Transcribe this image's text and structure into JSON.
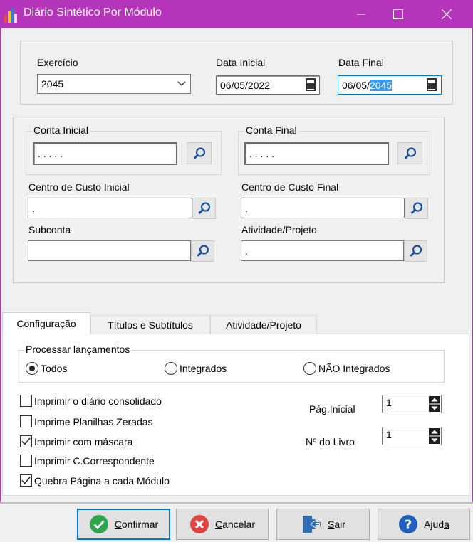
{
  "window": {
    "title": "Diário Sintético Por Módulo",
    "accent_color": "#b535ba",
    "controls": [
      "minimize-icon",
      "maximize-icon",
      "close-icon"
    ]
  },
  "period": {
    "exercicio_label": "Exercício",
    "exercicio_value": "2045",
    "data_inicial_label": "Data Inicial",
    "data_inicial_value": "06/05/2022",
    "data_final_label": "Data Final",
    "data_final_prefix": "06/05/",
    "data_final_selected": "2045"
  },
  "accounts": {
    "conta_inicial_label": "Conta Inicial",
    "conta_inicial_value": ". . . . .",
    "conta_final_label": "Conta Final",
    "conta_final_value": ". . . . .",
    "cc_inicial_label": "Centro de Custo Inicial",
    "cc_inicial_value": ".",
    "cc_final_label": "Centro de Custo Final",
    "cc_final_value": ".",
    "subconta_label": "Subconta",
    "subconta_value": "",
    "atividade_label": "Atividade/Projeto",
    "atividade_value": "."
  },
  "tabs": [
    {
      "label": "Configuração",
      "active": true
    },
    {
      "label": "Títulos e Subtítulos",
      "active": false
    },
    {
      "label": "Atividade/Projeto",
      "active": false
    }
  ],
  "processar": {
    "label": "Processar lançamentos",
    "options": [
      {
        "label": "Todos",
        "selected": true
      },
      {
        "label": "Integrados",
        "selected": false
      },
      {
        "label": "NÃO Integrados",
        "selected": false
      }
    ]
  },
  "options": [
    {
      "label": "Imprimir o diário consolidado",
      "checked": false
    },
    {
      "label": "Imprime Planilhas Zeradas",
      "checked": false
    },
    {
      "label": "Imprimir com máscara",
      "checked": true
    },
    {
      "label": "Imprimir C.Correspondente",
      "checked": false
    },
    {
      "label": "Quebra Página a cada Módulo",
      "checked": true
    }
  ],
  "pag_inicial": {
    "label": "Pág.Inicial",
    "value": "1"
  },
  "num_livro": {
    "label": "Nº do Livro",
    "value": "1"
  },
  "buttons": {
    "confirmar": {
      "before": "",
      "mnemonic": "C",
      "after": "onfirmar"
    },
    "cancelar": {
      "before": "",
      "mnemonic": "C",
      "after": "ancelar"
    },
    "sair": {
      "before": "",
      "mnemonic": "S",
      "after": "air"
    },
    "ajuda": {
      "before": "Ajud",
      "mnemonic": "a",
      "after": ""
    }
  }
}
